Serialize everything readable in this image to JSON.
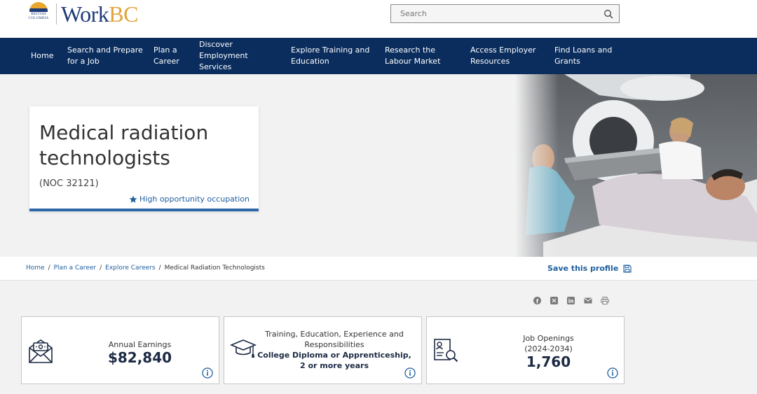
{
  "header": {
    "logo_small_text": "BRITISH COLUMBIA",
    "logo_work": "Work",
    "logo_bc": "BC",
    "search_placeholder": "Search"
  },
  "nav": [
    {
      "label": "Home"
    },
    {
      "label": "Search and Prepare for a Job"
    },
    {
      "label": "Plan a Career"
    },
    {
      "label": "Discover Employment Services"
    },
    {
      "label": "Explore Training and Education"
    },
    {
      "label": "Research the Labour Market"
    },
    {
      "label": "Access Employer Resources"
    },
    {
      "label": "Find Loans and Grants"
    }
  ],
  "hero": {
    "title": "Medical radiation technologists",
    "noc": "(NOC 32121)",
    "opportunity": "High opportunity occupation"
  },
  "breadcrumb": {
    "items": [
      "Home",
      "Plan a Career",
      "Explore Careers"
    ],
    "current": "Medical Radiation Technologists",
    "separator": "/"
  },
  "save_profile": "Save this profile",
  "share_icons": [
    "facebook-icon",
    "x-icon",
    "linkedin-icon",
    "email-icon",
    "print-icon"
  ],
  "cards": {
    "earnings": {
      "label": "Annual Earnings",
      "value": "$82,840"
    },
    "training": {
      "label": "Training, Education, Experience and Responsibilities",
      "value": "College Diploma or Apprenticeship, 2 or more years"
    },
    "openings": {
      "label": "Job Openings",
      "period": "(2024-2034)",
      "value": "1,760"
    }
  },
  "colors": {
    "nav_bg": "#0a2d5e",
    "accent_blue": "#1f5fa0",
    "brand_gold": "#e2a33b"
  }
}
